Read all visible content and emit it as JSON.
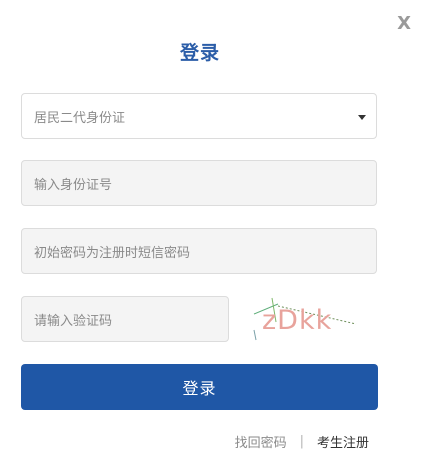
{
  "dialog": {
    "close_label": "X",
    "title": "登录"
  },
  "form": {
    "id_type_selected": "居民二代身份证",
    "id_number_placeholder": "输入身份证号",
    "password_placeholder": "初始密码为注册时短信密码",
    "captcha_placeholder": "请输入验证码",
    "captcha_text": "zDkk",
    "submit_label": "登录"
  },
  "links": {
    "forgot_password": "找回密码",
    "separator": "|",
    "register": "考生注册"
  },
  "colors": {
    "accent": "#1f57a6",
    "title": "#2b5da8"
  }
}
